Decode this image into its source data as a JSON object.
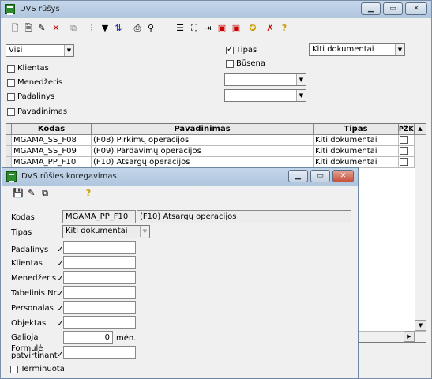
{
  "main_window": {
    "title": "DVS rūšys"
  },
  "dialog": {
    "title": "DVS rūšies koregavimas"
  },
  "filters": {
    "filter_value": "Visi",
    "klientas_label": "Klientas",
    "menedzeris_label": "Menedžeris",
    "padalinys_label": "Padalinys",
    "pavadinimas_label": "Pavadinimas",
    "tipas_label": "Tipas",
    "busena_label": "Būsena",
    "tipas_value": "Kiti dokumentai"
  },
  "grid": {
    "headers": {
      "kodas": "Kodas",
      "pavadinimas": "Pavadinimas",
      "tipas": "Tipas",
      "pz": "PŽ",
      "k": "K"
    },
    "rows": [
      {
        "kodas": "MGAMA_SS_F08",
        "pavadinimas": "(F08) Pirkimų operacijos",
        "tipas": "Kiti dokumentai"
      },
      {
        "kodas": "MGAMA_SS_F09",
        "pavadinimas": "(F09) Pardavimų operacijos",
        "tipas": "Kiti dokumentai"
      },
      {
        "kodas": "MGAMA_PP_F10",
        "pavadinimas": "(F10) Atsargų operacijos",
        "tipas": "Kiti dokumentai"
      }
    ]
  },
  "form": {
    "kodas_label": "Kodas",
    "kodas_value": "MGAMA_PP_F10",
    "name_value": "(F10) Atsargų operacijos",
    "tipas_label": "Tipas",
    "tipas_value": "Kiti dokumentai",
    "padalinys_label": "Padalinys",
    "klientas_label": "Klientas",
    "menedzeris_label": "Menedžeris",
    "tabelinis_label": "Tabelinis Nr.",
    "personalas_label": "Personalas",
    "objektas_label": "Objektas",
    "galioja_label": "Galioja",
    "galioja_value": "0",
    "galioja_unit": "mėn.",
    "formule_label_1": "Formulė",
    "formule_label_2": "patvirtinant",
    "terminuota_label": "Terminuota"
  }
}
